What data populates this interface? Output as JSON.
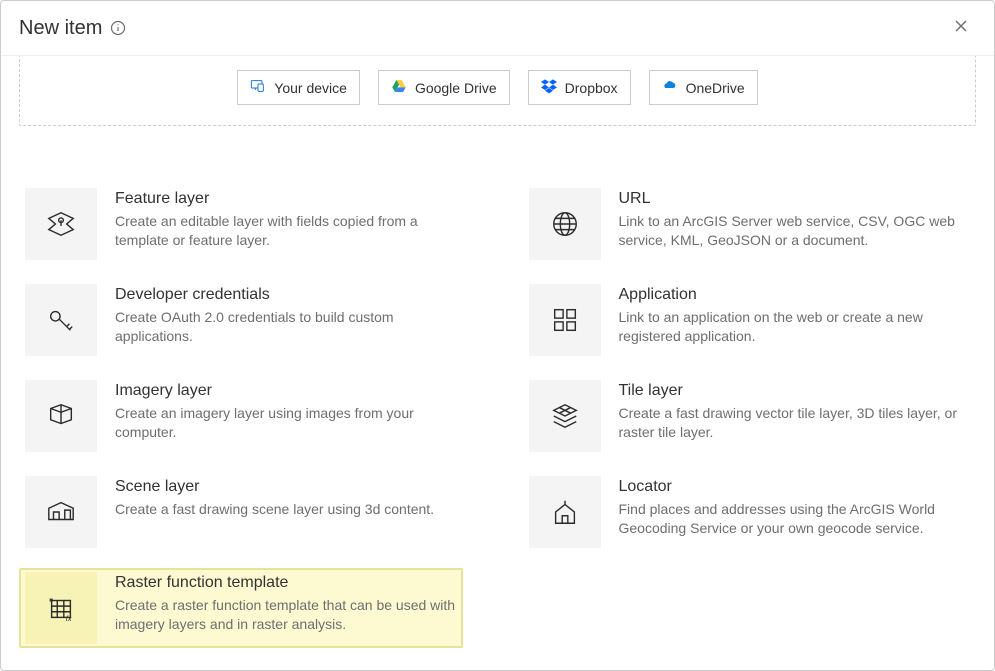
{
  "header": {
    "title": "New item"
  },
  "sources": [
    {
      "id": "your-device",
      "label": "Your device"
    },
    {
      "id": "google-drive",
      "label": "Google Drive"
    },
    {
      "id": "dropbox",
      "label": "Dropbox"
    },
    {
      "id": "onedrive",
      "label": "OneDrive"
    }
  ],
  "itemsLeft": [
    {
      "id": "feature-layer",
      "title": "Feature layer",
      "desc": "Create an editable layer with fields copied from a template or feature layer."
    },
    {
      "id": "developer-credentials",
      "title": "Developer credentials",
      "desc": "Create OAuth 2.0 credentials to build custom applications."
    },
    {
      "id": "imagery-layer",
      "title": "Imagery layer",
      "desc": "Create an imagery layer using images from your computer."
    },
    {
      "id": "scene-layer",
      "title": "Scene layer",
      "desc": "Create a fast drawing scene layer using 3d content."
    },
    {
      "id": "raster-function-template",
      "title": "Raster function template",
      "desc": "Create a raster function template that can be used with imagery layers and in raster analysis.",
      "highlight": true
    }
  ],
  "itemsRight": [
    {
      "id": "url",
      "title": "URL",
      "desc": "Link to an ArcGIS Server web service, CSV, OGC web service, KML, GeoJSON or a document."
    },
    {
      "id": "application",
      "title": "Application",
      "desc": "Link to an application on the web or create a new registered application."
    },
    {
      "id": "tile-layer",
      "title": "Tile layer",
      "desc": "Create a fast drawing vector tile layer, 3D tiles layer, or raster tile layer."
    },
    {
      "id": "locator",
      "title": "Locator",
      "desc": "Find places and addresses using the ArcGIS World Geocoding Service or your own geocode service."
    }
  ]
}
